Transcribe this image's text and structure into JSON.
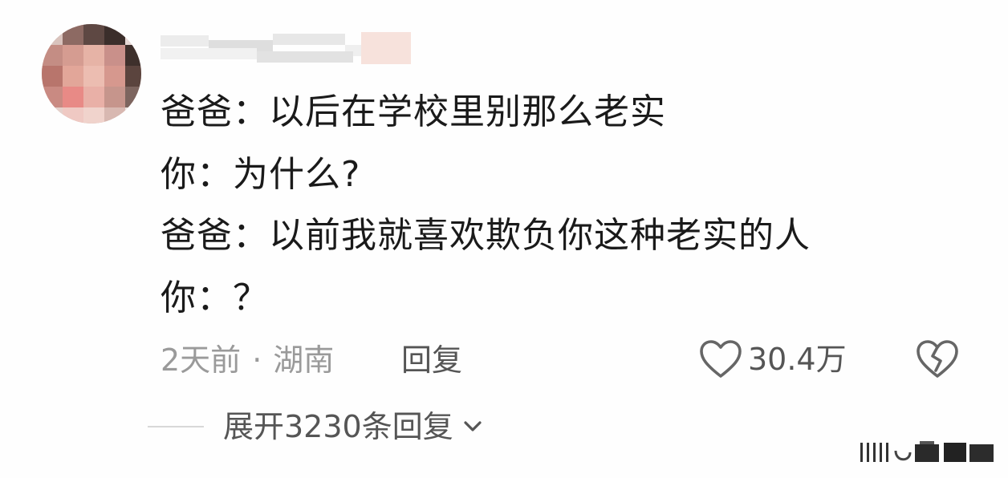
{
  "comment": {
    "lines": [
      {
        "speaker": "爸爸：",
        "text": "以后在学校里别那么老实"
      },
      {
        "speaker": "你：",
        "text": "为什么?"
      },
      {
        "speaker": "爸爸：",
        "text": "以前我就喜欢欺负你这种老实的人"
      },
      {
        "speaker": "你：",
        "text": "？"
      }
    ],
    "time": "2天前",
    "separator": "·",
    "location": "湖南",
    "reply_label": "回复",
    "like_count": "30.4万",
    "expand_label": "展开3230条回复"
  },
  "icons": {
    "like": "heart-outline-icon",
    "dislike": "broken-heart-icon",
    "expand": "chevron-down-icon"
  },
  "colors": {
    "text": "#1a1a1a",
    "meta": "#9a9a9a",
    "action": "#555555",
    "background": "#fefefe"
  }
}
